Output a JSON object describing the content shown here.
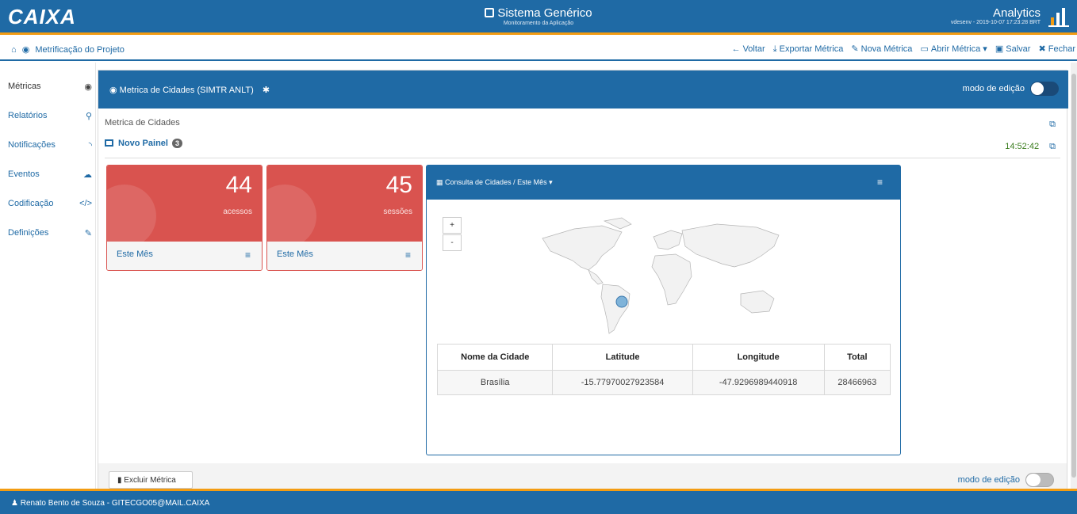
{
  "header": {
    "logo": "CAIXA",
    "system_title": "Sistema Genérico",
    "system_subtitle": "Monitoramento da Aplicação",
    "app_title": "Analytics",
    "app_subtitle": "vdesenv - 2019-10-07 17:23:28 BRT"
  },
  "toolbar": {
    "breadcrumb": "Metrificação do Projeto",
    "actions": [
      {
        "label": "Voltar",
        "icon": "arrow-left-icon"
      },
      {
        "label": "Exportar Métrica",
        "icon": "download-icon"
      },
      {
        "label": "Nova Métrica",
        "icon": "magic-icon"
      },
      {
        "label": "Abrir Métrica ▾",
        "icon": "folder-open-icon"
      },
      {
        "label": "Salvar",
        "icon": "save-icon"
      },
      {
        "label": "Fechar",
        "icon": "close-icon"
      }
    ]
  },
  "sidebar": {
    "items": [
      {
        "label": "Métricas",
        "icon": "dashboard-icon"
      },
      {
        "label": "Relatórios",
        "icon": "search-icon"
      },
      {
        "label": "Notificações",
        "icon": "rss-icon"
      },
      {
        "label": "Eventos",
        "icon": "cloud-icon"
      },
      {
        "label": "Codificação",
        "icon": "code-icon"
      },
      {
        "label": "Definições",
        "icon": "edit-icon"
      }
    ]
  },
  "panel": {
    "title": "Metrica de Cidades (SIMTR ANLT)",
    "edit_mode_label": "modo de edição",
    "metric_label": "Metrica de Cidades",
    "board_name": "Novo Painel",
    "board_badge": "3",
    "clock": "14:52:42"
  },
  "cards": [
    {
      "value": "44",
      "label": "acessos",
      "period": "Este Mês"
    },
    {
      "value": "45",
      "label": "sessões",
      "period": "Este Mês"
    }
  ],
  "map_widget": {
    "title": "Consulta de Cidades / Este Mês",
    "zoom_in": "+",
    "zoom_out": "-",
    "columns": [
      "Nome da Cidade",
      "Latitude",
      "Longitude",
      "Total"
    ],
    "rows": [
      [
        "Brasília",
        "-15.77970027923584",
        "-47.9296989440918",
        "28466963"
      ]
    ]
  },
  "footer": {
    "delete_label": "Excluir Métrica",
    "edit_mode_label": "modo de edição"
  },
  "bottom": {
    "user": "Renato Bento de Souza  - GITECGO05@MAIL.CAIXA"
  },
  "colors": {
    "primary": "#1f6aa5",
    "accent": "#f39c12",
    "danger": "#d9534f",
    "clock": "#3a7d1e"
  }
}
